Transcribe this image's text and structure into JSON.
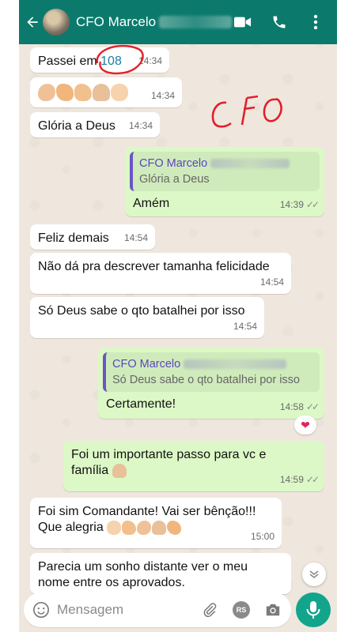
{
  "header": {
    "contact_name": "CFO Marcelo",
    "back_icon": "arrow-left-icon",
    "avatar_icon": "contact-avatar",
    "icons": [
      "video-call-icon",
      "phone-call-icon",
      "more-vertical-icon"
    ]
  },
  "annotation": {
    "handwritten": "CFO",
    "circled_text": "108",
    "color": "#e0202a"
  },
  "messages": [
    {
      "dir": "in",
      "text_before": "Passei em ",
      "link": "108",
      "time": "14:34"
    },
    {
      "dir": "in",
      "emojis": [
        "clapping-hands-emoji",
        "flexed-biceps-emoji",
        "thumbs-up-emoji",
        "folded-hands-emoji",
        "raising-hands-emoji"
      ],
      "time": "14:34"
    },
    {
      "dir": "in",
      "text": "Glória a Deus",
      "time": "14:34"
    },
    {
      "dir": "out",
      "quote_name": "CFO Marcelo",
      "quote_text": "Glória a Deus",
      "text": "Amém",
      "time": "14:39"
    },
    {
      "dir": "in",
      "text": "Feliz demais",
      "time": "14:54"
    },
    {
      "dir": "in",
      "text": "Não dá pra descrever tamanha felicidade",
      "time": "14:54"
    },
    {
      "dir": "in",
      "text": "Só Deus sabe o qto batalhei por isso",
      "time": "14:54"
    },
    {
      "dir": "out",
      "quote_name": "CFO Marcelo",
      "quote_text": "Só Deus sabe o qto batalhei por isso",
      "text": "Certamente!",
      "time": "14:58",
      "reaction": "❤"
    },
    {
      "dir": "out",
      "line1": "Foi um importante passo para vc e",
      "line2": "família",
      "emoji": "folded-hands-emoji",
      "time": "14:59"
    },
    {
      "dir": "in",
      "line1": "Foi sim Comandante! Vai ser bênção!!!",
      "line2": "Que alegria",
      "emojis": [
        "raising-hands-emoji",
        "thumbs-up-emoji",
        "clapping-hands-emoji",
        "folded-hands-emoji",
        "flexed-biceps-emoji"
      ],
      "time": "15:00"
    },
    {
      "dir": "in",
      "line1": "Parecia um sonho distante ver o meu",
      "line2": "nome entre os aprovados."
    }
  ],
  "composer": {
    "placeholder": "Mensagem",
    "rs_badge": "RS",
    "icons": [
      "emoji-icon",
      "attach-icon",
      "rs-sticker-icon",
      "camera-icon",
      "mic-icon"
    ]
  },
  "colors": {
    "header_bg": "#0b7a6c",
    "outgoing_bubble": "#dcf8c6",
    "incoming_bubble": "#ffffff",
    "chat_bg": "#efe7de",
    "mic_button": "#12a58c"
  }
}
